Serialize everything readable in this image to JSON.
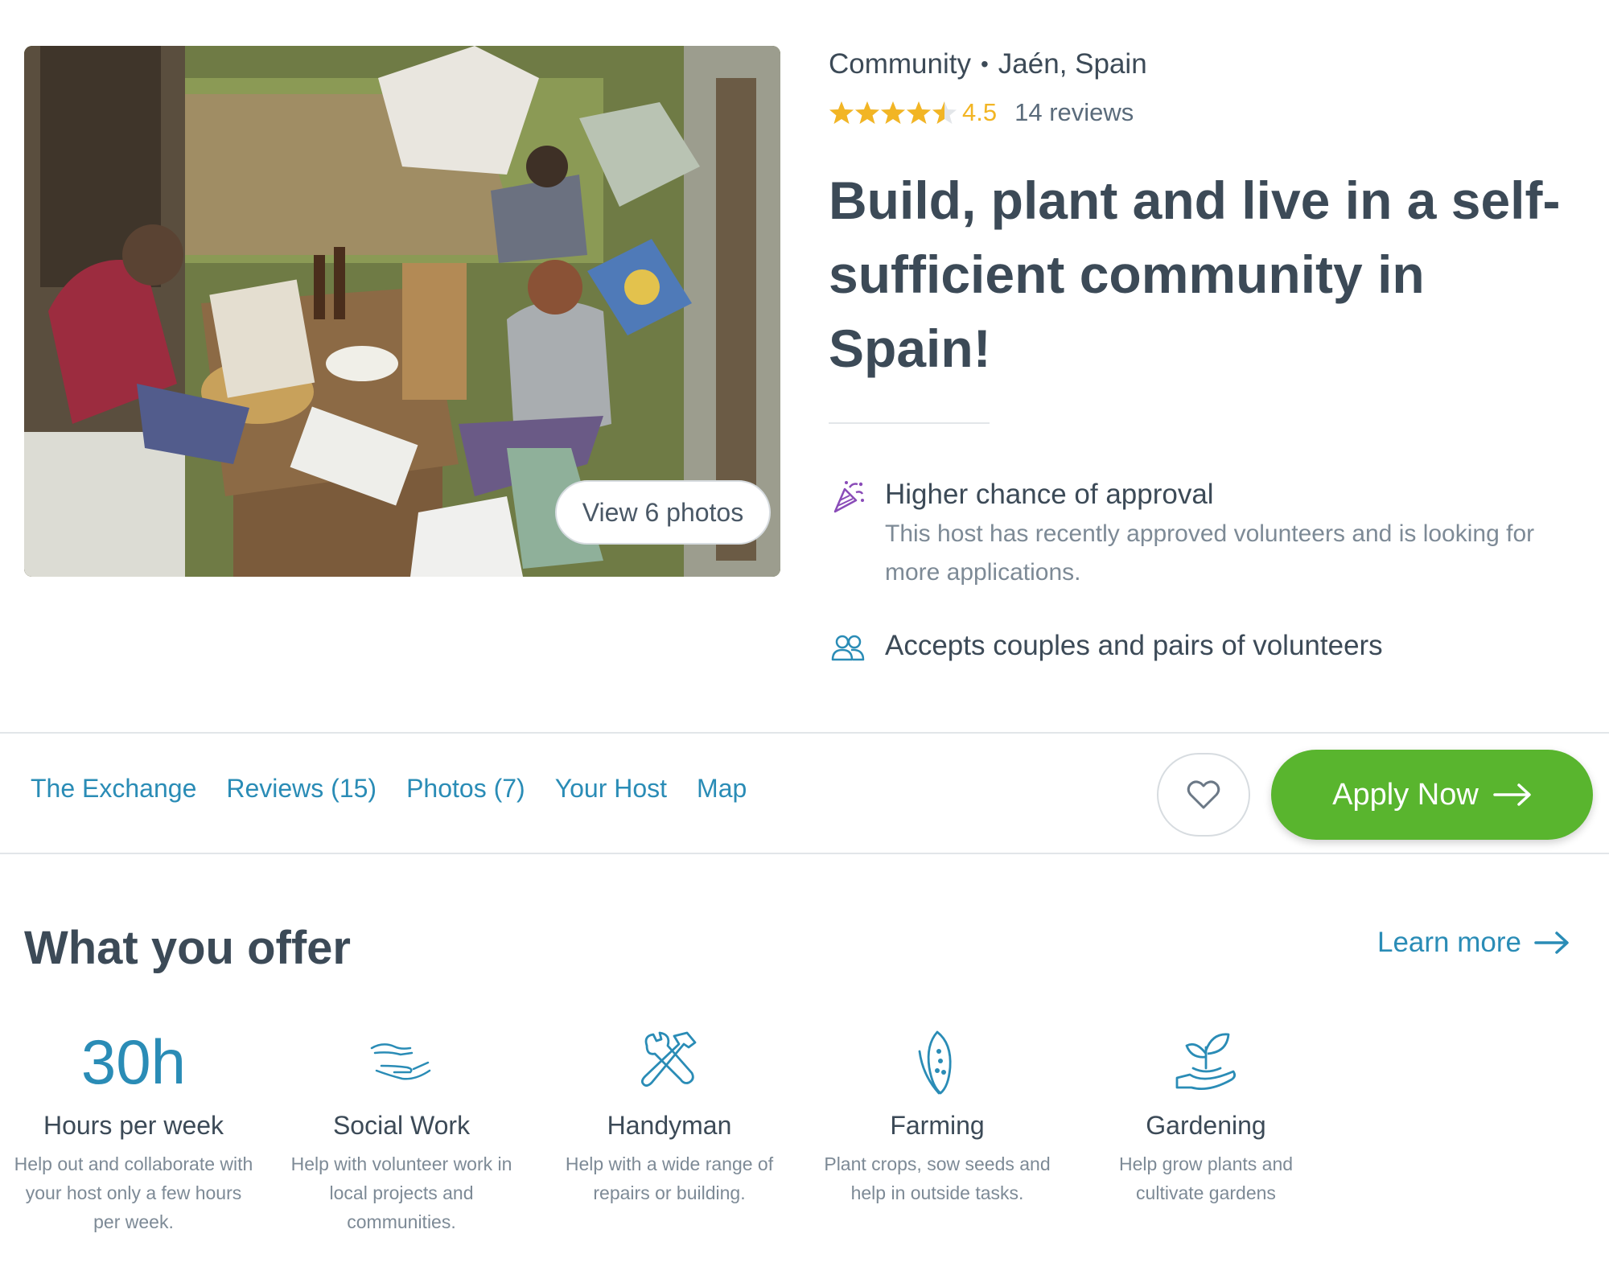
{
  "listing": {
    "category": "Community",
    "separator": "•",
    "location": "Jaén, Spain",
    "rating": 4.5,
    "rating_text": "4.5",
    "reviews_text": "14 reviews",
    "title": "Build, plant and live in a self-sufficient community in Spain!",
    "photo_button": "View 6 photos"
  },
  "features": [
    {
      "icon": "party-popper-icon",
      "title": "Higher chance of approval",
      "description": "This host has recently approved volunteers and is looking for more applications."
    },
    {
      "icon": "people-icon",
      "title": "Accepts couples and pairs of volunteers"
    }
  ],
  "tabs": [
    {
      "label": "The Exchange"
    },
    {
      "label": "Reviews (15)"
    },
    {
      "label": "Photos (7)"
    },
    {
      "label": "Your Host"
    },
    {
      "label": "Map"
    }
  ],
  "actions": {
    "apply_label": "Apply Now",
    "favorite_icon": "heart-icon"
  },
  "offer": {
    "heading": "What you offer",
    "learn_more": "Learn more",
    "items": [
      {
        "value": "30h",
        "title": "Hours per week",
        "description": "Help out and collaborate with your host only a few hours per week."
      },
      {
        "icon": "hands-icon",
        "title": "Social Work",
        "description": "Help with volunteer work in local projects and communities."
      },
      {
        "icon": "tools-icon",
        "title": "Handyman",
        "description": "Help with a wide range of repairs or building."
      },
      {
        "icon": "corn-icon",
        "title": "Farming",
        "description": "Plant crops, sow seeds and help in outside tasks."
      },
      {
        "icon": "plant-in-hand-icon",
        "title": "Gardening",
        "description": "Help grow plants and cultivate gardens"
      }
    ]
  },
  "colors": {
    "accent": "#2a8cb6",
    "apply_green": "#59b52e",
    "star": "#f2b524",
    "text": "#3c4a57",
    "muted": "#7d8a96"
  }
}
